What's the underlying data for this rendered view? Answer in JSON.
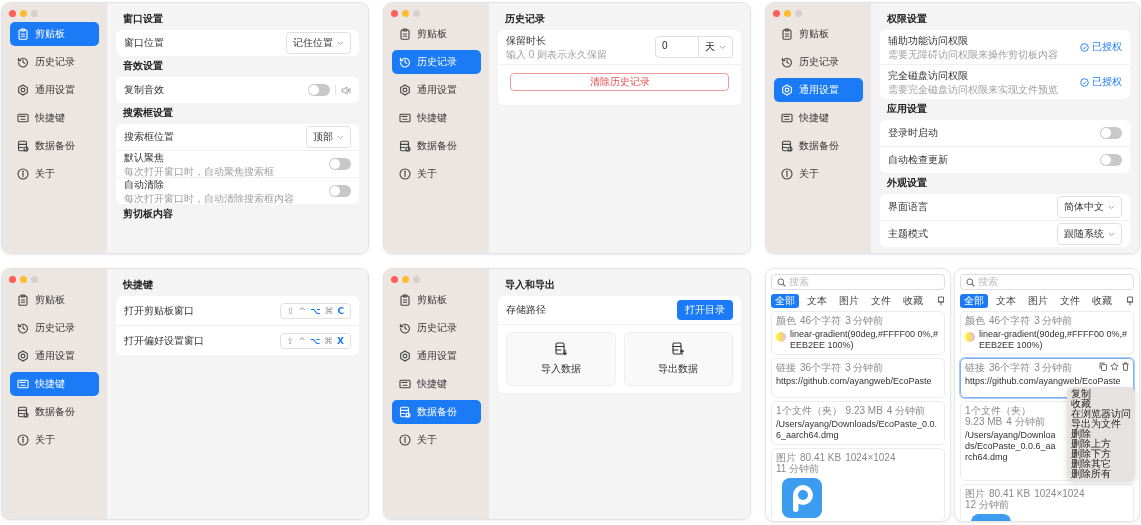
{
  "windows": [
    {
      "sidebar": [
        {
          "label": "剪贴板",
          "selected": true
        },
        {
          "label": "历史记录",
          "selected": false
        },
        {
          "label": "通用设置",
          "selected": false
        },
        {
          "label": "快捷键",
          "selected": false
        },
        {
          "label": "数据备份",
          "selected": false
        },
        {
          "label": "关于",
          "selected": false
        }
      ],
      "sections": [
        {
          "title": "窗口设置",
          "rows": [
            {
              "kind": "select",
              "label": "窗口位置",
              "value": "记住位置"
            }
          ]
        },
        {
          "title": "音效设置",
          "rows": [
            {
              "kind": "sound_toggle",
              "label": "复制音效",
              "on": false
            }
          ]
        },
        {
          "title": "搜索框设置",
          "rows": [
            {
              "kind": "select",
              "label": "搜索框位置",
              "value": "顶部"
            },
            {
              "kind": "toggle",
              "label": "默认聚焦",
              "description": "每次打开窗口时，自动聚焦搜索框",
              "on": false
            },
            {
              "kind": "toggle",
              "label": "自动清除",
              "description": "每次打开窗口时，自动清除搜索框内容",
              "on": false
            }
          ]
        },
        {
          "title": "剪切板内容"
        }
      ]
    },
    {
      "sidebar": [
        {
          "label": "剪贴板",
          "selected": false
        },
        {
          "label": "历史记录",
          "selected": true
        },
        {
          "label": "通用设置",
          "selected": false
        },
        {
          "label": "快捷键",
          "selected": false
        },
        {
          "label": "数据备份",
          "selected": false
        },
        {
          "label": "关于",
          "selected": false
        }
      ],
      "sections": [
        {
          "title": "历史记录",
          "rows": [
            {
              "kind": "number",
              "label": "保留时长",
              "description": "输入 0 则表示永久保留",
              "value": "0",
              "unit": "天"
            },
            {
              "kind": "danger_button",
              "label": "清除历史记录"
            }
          ]
        }
      ]
    },
    {
      "sidebar": [
        {
          "label": "剪贴板",
          "selected": false
        },
        {
          "label": "历史记录",
          "selected": false
        },
        {
          "label": "通用设置",
          "selected": true
        },
        {
          "label": "快捷键",
          "selected": false
        },
        {
          "label": "数据备份",
          "selected": false
        },
        {
          "label": "关于",
          "selected": false
        }
      ],
      "sections": [
        {
          "title": "权限设置",
          "rows": [
            {
              "kind": "permission",
              "label": "辅助功能访问权限",
              "description": "需要无障碍访问权限来操作剪切板内容",
              "status": "已授权",
              "granted": true
            },
            {
              "kind": "permission",
              "label": "完全磁盘访问权限",
              "description": "需要完全磁盘访问权限来实现文件预览",
              "status": "已授权",
              "granted": true
            }
          ]
        },
        {
          "title": "应用设置",
          "rows": [
            {
              "kind": "toggle",
              "label": "登录时启动",
              "on": false
            },
            {
              "kind": "toggle",
              "label": "自动检查更新",
              "on": false
            }
          ]
        },
        {
          "title": "外观设置",
          "rows": [
            {
              "kind": "select",
              "label": "界面语言",
              "value": "简体中文"
            },
            {
              "kind": "select",
              "label": "主题模式",
              "value": "跟随系统"
            }
          ]
        }
      ]
    },
    {
      "sidebar": [
        {
          "label": "剪贴板",
          "selected": false
        },
        {
          "label": "历史记录",
          "selected": false
        },
        {
          "label": "通用设置",
          "selected": false
        },
        {
          "label": "快捷键",
          "selected": true
        },
        {
          "label": "数据备份",
          "selected": false
        },
        {
          "label": "关于",
          "selected": false
        }
      ],
      "sections": [
        {
          "title": "快捷键",
          "rows": [
            {
              "kind": "shortcut",
              "label": "打开剪贴板窗口",
              "keys": [
                {
                  "key": "⇧",
                  "active": false
                },
                {
                  "key": "^",
                  "active": false
                },
                {
                  "key": "⌥",
                  "active": true
                },
                {
                  "key": "⌘",
                  "active": false
                },
                {
                  "key": "C",
                  "active": true
                }
              ]
            },
            {
              "kind": "shortcut",
              "label": "打开偏好设置窗口",
              "keys": [
                {
                  "key": "⇧",
                  "active": false
                },
                {
                  "key": "^",
                  "active": false
                },
                {
                  "key": "⌥",
                  "active": true
                },
                {
                  "key": "⌘",
                  "active": false
                },
                {
                  "key": "X",
                  "active": true
                }
              ]
            }
          ]
        }
      ]
    },
    {
      "sidebar": [
        {
          "label": "剪贴板",
          "selected": false
        },
        {
          "label": "历史记录",
          "selected": false
        },
        {
          "label": "通用设置",
          "selected": false
        },
        {
          "label": "快捷键",
          "selected": false
        },
        {
          "label": "数据备份",
          "selected": true
        },
        {
          "label": "关于",
          "selected": false
        }
      ],
      "sections": [
        {
          "title": "导入和导出",
          "rows": [
            {
              "kind": "path",
              "label": "存储路径",
              "button": "打开目录"
            },
            {
              "kind": "tiles",
              "tiles": [
                {
                  "label": "导入数据"
                },
                {
                  "label": "导出数据"
                }
              ]
            }
          ]
        }
      ]
    }
  ],
  "panels": [
    {
      "search": {
        "placeholder": "搜索"
      },
      "tabs": [
        {
          "label": "全部",
          "selected": true
        },
        {
          "label": "文本",
          "selected": false
        },
        {
          "label": "图片",
          "selected": false
        },
        {
          "label": "文件",
          "selected": false
        },
        {
          "label": "收藏",
          "selected": false
        }
      ],
      "items": [
        {
          "kind": "color",
          "meta": [
            "颜色",
            "46个字符",
            "3 分钟前"
          ],
          "text": "linear-gradient(90deg,#FFFF00 0%,#EEB2EE 100%)",
          "selected": false
        },
        {
          "kind": "text",
          "meta": [
            "链接",
            "36个字符",
            "3 分钟前"
          ],
          "text": "https://github.com/ayangweb/EcoPaste",
          "selected": false
        },
        {
          "kind": "text",
          "meta": [
            "1个文件（夹）",
            "9.23 MB",
            "4 分钟前"
          ],
          "text": "/Users/ayang/Downloads/EcoPaste_0.0.6_aarch64.dmg",
          "selected": false
        },
        {
          "meta": [
            "图片",
            "80.41 KB",
            "1024×1024",
            "11 分钟前"
          ],
          "selected": false
        }
      ]
    },
    {
      "search": {
        "placeholder": "搜索"
      },
      "tabs": [
        {
          "label": "全部",
          "selected": true
        },
        {
          "label": "文本",
          "selected": false
        },
        {
          "label": "图片",
          "selected": false
        },
        {
          "label": "文件",
          "selected": false
        },
        {
          "label": "收藏",
          "selected": false
        }
      ],
      "items": [
        {
          "kind": "color",
          "meta": [
            "颜色",
            "46个字符",
            "3 分钟前"
          ],
          "text": "linear-gradient(90deg,#FFFF00 0%,#EEB2EE 100%)",
          "selected": false
        },
        {
          "kind": "text",
          "meta": [
            "链接",
            "36个字符",
            "3 分钟前"
          ],
          "text": "https://github.com/ayangweb/EcoPaste",
          "selected": true
        },
        {
          "kind": "text",
          "meta": [
            "1个文件（夹）",
            "9.23 MB",
            "4 分钟前"
          ],
          "text": "/Users/ayang/Downloads/EcoPaste_0.0.6_aarch64.dmg",
          "selected": false,
          "under_menu": true
        },
        {
          "meta": [
            "图片",
            "80.41 KB",
            "1024×1024",
            "12 分钟前"
          ],
          "selected": false
        }
      ],
      "context_menu": [
        "复制",
        "收藏",
        "在浏览器访问",
        "导出为文件",
        "删除",
        "删除上方",
        "删除下方",
        "删除其它",
        "删除所有"
      ]
    }
  ]
}
